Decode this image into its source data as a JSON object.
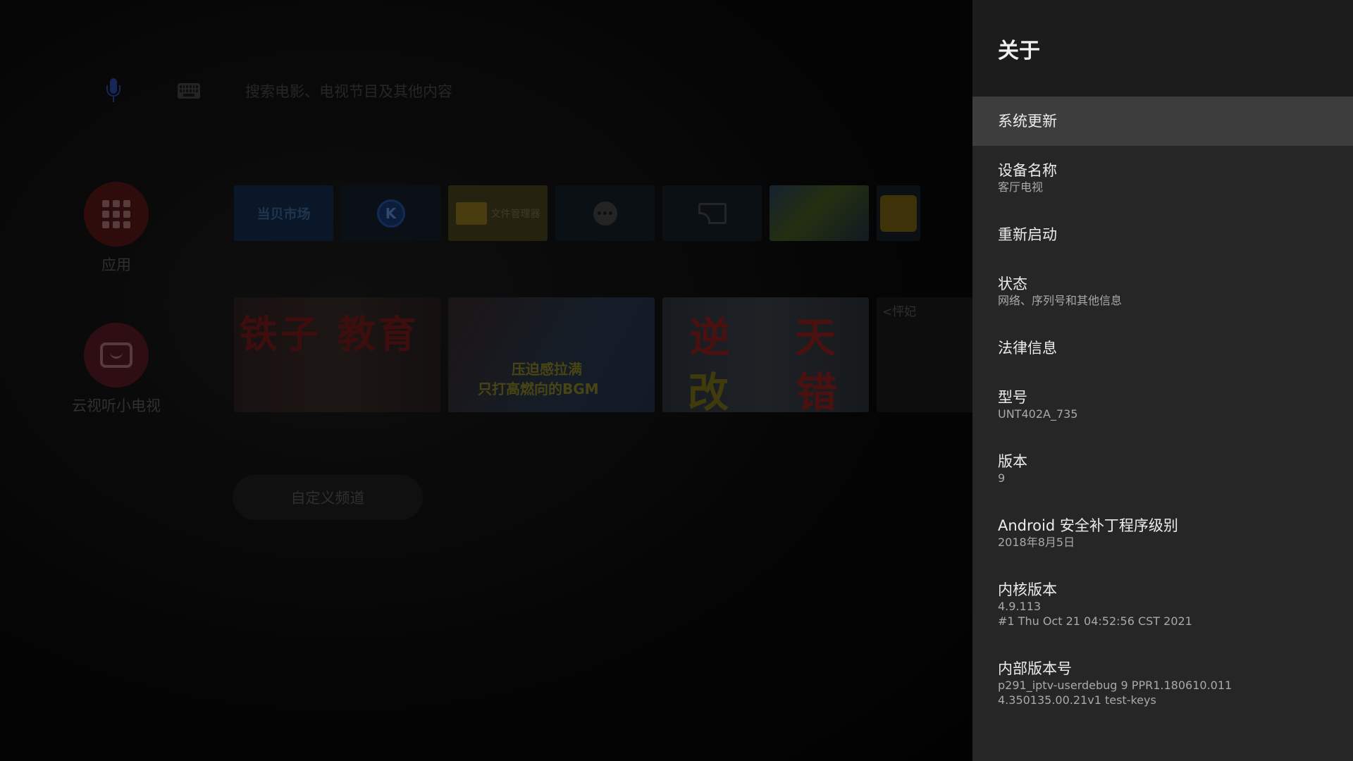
{
  "launcher": {
    "search_placeholder": "搜索电影、电视节目及其他内容",
    "side_tiles": [
      {
        "label": "应用"
      },
      {
        "label": "云视听小电视"
      }
    ],
    "apps": [
      {
        "name": "当贝市场"
      },
      {
        "name": "K"
      },
      {
        "name": "文件管理器"
      }
    ],
    "cards": [
      {
        "text": "铁子 教育"
      },
      {
        "text1": "压迫感拉满",
        "text2": "只打高燃向的BGM"
      },
      {
        "t1": "逆",
        "t2": "天",
        "t3": "改",
        "t4": "错"
      },
      {
        "text": "<怦妃"
      }
    ],
    "custom_channel_label": "自定义频道"
  },
  "panel": {
    "title": "关于",
    "items": [
      {
        "title": "系统更新",
        "focused": true
      },
      {
        "title": "设备名称",
        "subtitle": "客厅电视"
      },
      {
        "title": "重新启动"
      },
      {
        "title": "状态",
        "subtitle": "网络、序列号和其他信息"
      },
      {
        "title": "法律信息"
      },
      {
        "title": "型号",
        "subtitle": "UNT402A_735"
      },
      {
        "title": "版本",
        "subtitle": "9"
      },
      {
        "title": "Android 安全补丁程序级别",
        "subtitle": "2018年8月5日"
      },
      {
        "title": "内核版本",
        "subtitle": "4.9.113",
        "subtitle2": "#1 Thu Oct 21 04:52:56 CST 2021"
      },
      {
        "title": "内部版本号",
        "subtitle": "p291_iptv-userdebug 9 PPR1.180610.011",
        "subtitle2": "4.350135.00.21v1 test-keys"
      }
    ]
  },
  "colors": {
    "panel_bg": "#262626",
    "panel_header_bg": "#1c1c1c",
    "focused_bg": "#3d3d3d",
    "title_text": "#ececec",
    "subtitle_text": "#a9a9a9"
  }
}
